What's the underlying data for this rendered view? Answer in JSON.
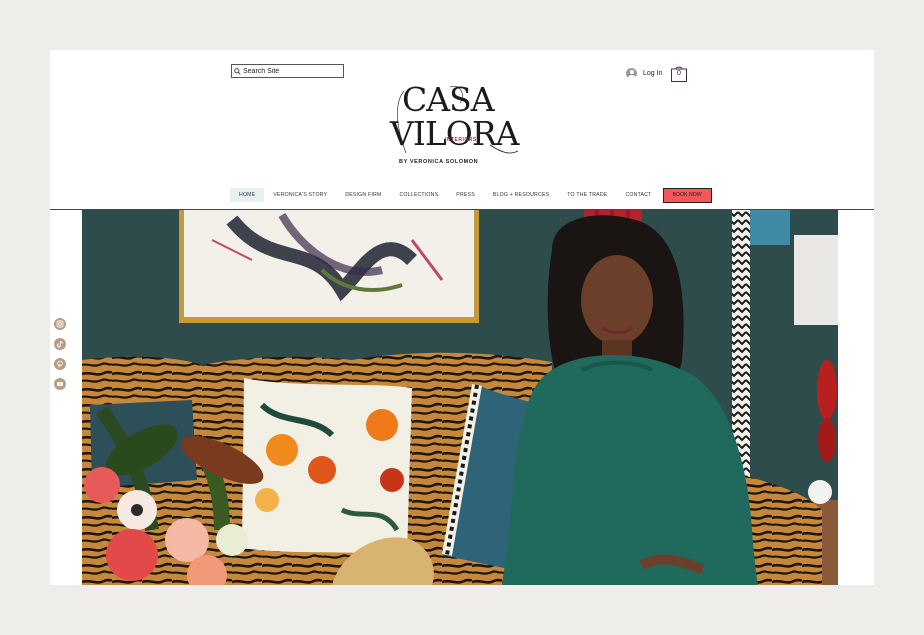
{
  "header": {
    "search_placeholder": "Search Site",
    "login_label": "Log In",
    "cart_count": "0"
  },
  "logo": {
    "line1": "CASA",
    "line2": "VILORA",
    "interiors": "INTERIORS",
    "byline": "BY VERONICA SOLOMON"
  },
  "nav": {
    "items": [
      {
        "label": "HOME"
      },
      {
        "label": "VERONICA'S STORY"
      },
      {
        "label": "DESIGN FIRM"
      },
      {
        "label": "COLLECTIONS"
      },
      {
        "label": "PRESS"
      },
      {
        "label": "BLOG + RESOURCES"
      },
      {
        "label": "TO THE TRADE"
      },
      {
        "label": "CONTACT"
      }
    ],
    "book_label": "BOOK NOW",
    "active_index": 0
  },
  "social": [
    "instagram-icon",
    "tiktok-icon",
    "pinterest-icon",
    "youtube-icon"
  ],
  "colors": {
    "book_button": "#f4565b",
    "active_nav_bg": "#e6f0f3",
    "logo_accent": "#9b2e53",
    "social_icon": "#b99c80",
    "wall": "#2c4a49",
    "dress": "#1f6a5c"
  }
}
